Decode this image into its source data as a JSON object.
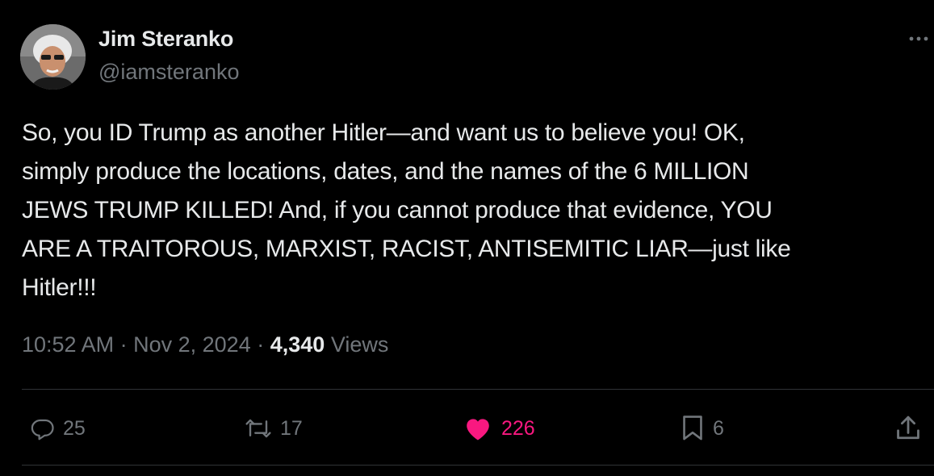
{
  "author": {
    "display_name": "Jim Steranko",
    "handle": "@iamsteranko",
    "avatar_icon": "profile-photo"
  },
  "tweet": {
    "text": "So, you ID Trump as another Hitler—and want us to believe you! OK,\nsimply produce the locations, dates, and the names of the 6 MILLION\nJEWS TRUMP KILLED! And, if you cannot produce that evidence, YOU\nARE A TRAITOROUS, MARXIST, RACIST, ANTISEMITIC LIAR—just like\nHitler!!!"
  },
  "meta": {
    "time": "10:52 AM",
    "separator": "·",
    "date": "Nov 2, 2024",
    "views_count": "4,340",
    "views_label": "Views"
  },
  "actions": {
    "reply_count": "25",
    "repost_count": "17",
    "like_count": "226",
    "bookmark_count": "6"
  },
  "colors": {
    "background": "#000000",
    "text_primary": "#e7e9ea",
    "text_secondary": "#71767b",
    "like_active": "#f91880",
    "divider": "#2f3336"
  }
}
